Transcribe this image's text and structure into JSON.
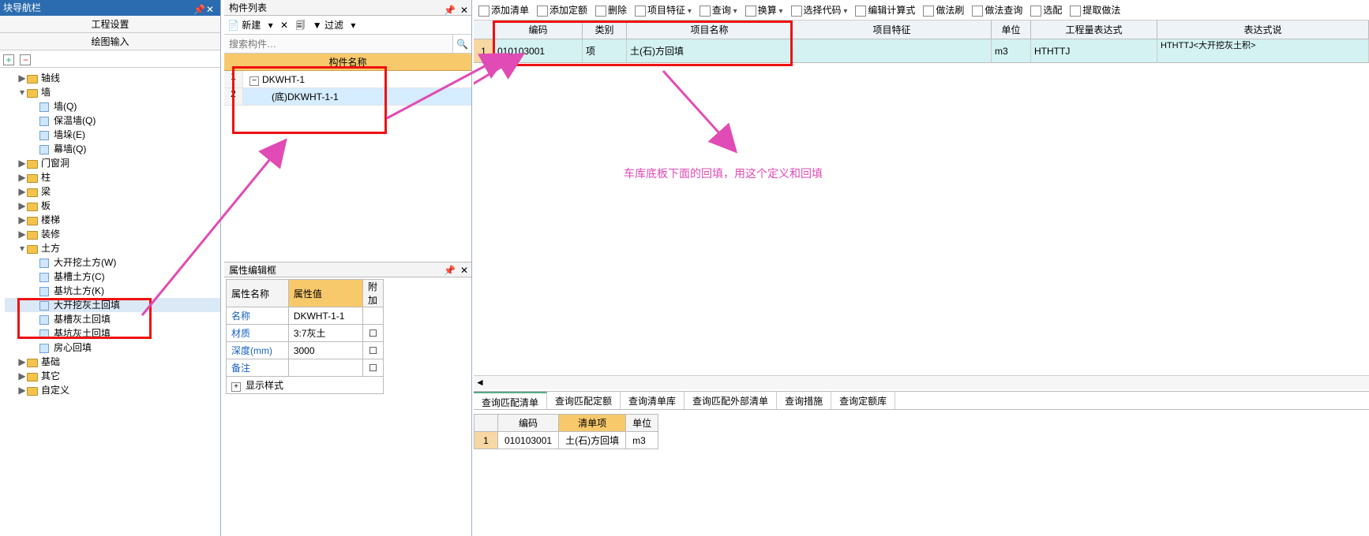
{
  "nav": {
    "title": "块导航栏",
    "header1": "工程设置",
    "header2": "绘图输入",
    "tree": [
      {
        "lvl": 0,
        "tg": "▶",
        "ic": "f",
        "label": "轴线"
      },
      {
        "lvl": 0,
        "tg": "▾",
        "ic": "f",
        "label": "墙"
      },
      {
        "lvl": 1,
        "tg": "",
        "ic": "l",
        "label": "墙(Q)"
      },
      {
        "lvl": 1,
        "tg": "",
        "ic": "l",
        "label": "保温墙(Q)"
      },
      {
        "lvl": 1,
        "tg": "",
        "ic": "l",
        "label": "墙垛(E)"
      },
      {
        "lvl": 1,
        "tg": "",
        "ic": "l",
        "label": "幕墙(Q)"
      },
      {
        "lvl": 0,
        "tg": "▶",
        "ic": "f",
        "label": "门窗洞"
      },
      {
        "lvl": 0,
        "tg": "▶",
        "ic": "f",
        "label": "柱"
      },
      {
        "lvl": 0,
        "tg": "▶",
        "ic": "f",
        "label": "梁"
      },
      {
        "lvl": 0,
        "tg": "▶",
        "ic": "f",
        "label": "板"
      },
      {
        "lvl": 0,
        "tg": "▶",
        "ic": "f",
        "label": "楼梯"
      },
      {
        "lvl": 0,
        "tg": "▶",
        "ic": "f",
        "label": "装修"
      },
      {
        "lvl": 0,
        "tg": "▾",
        "ic": "f",
        "label": "土方"
      },
      {
        "lvl": 1,
        "tg": "",
        "ic": "l",
        "label": "大开挖土方(W)"
      },
      {
        "lvl": 1,
        "tg": "",
        "ic": "l",
        "label": "基槽土方(C)"
      },
      {
        "lvl": 1,
        "tg": "",
        "ic": "l",
        "label": "基坑土方(K)"
      },
      {
        "lvl": 1,
        "tg": "",
        "ic": "l",
        "label": "大开挖灰土回填",
        "sel": true
      },
      {
        "lvl": 1,
        "tg": "",
        "ic": "l",
        "label": "基槽灰土回填"
      },
      {
        "lvl": 1,
        "tg": "",
        "ic": "l",
        "label": "基坑灰土回填"
      },
      {
        "lvl": 1,
        "tg": "",
        "ic": "l",
        "label": "房心回填"
      },
      {
        "lvl": 0,
        "tg": "▶",
        "ic": "f",
        "label": "基础"
      },
      {
        "lvl": 0,
        "tg": "▶",
        "ic": "f",
        "label": "其它"
      },
      {
        "lvl": 0,
        "tg": "▶",
        "ic": "f",
        "label": "自定义"
      }
    ]
  },
  "mid": {
    "title": "构件列表",
    "tool_new": "新建",
    "tool_filter": "过滤",
    "search_ph": "搜索构件…",
    "head": "构件名称",
    "rows": [
      {
        "n": "1",
        "label": "DKWHT-1",
        "tg": "−"
      },
      {
        "n": "2",
        "label": "(底)DKWHT-1-1",
        "sel": true
      }
    ]
  },
  "prop": {
    "title": "属性编辑框",
    "h1": "属性名称",
    "h2": "属性值",
    "h3": "附加",
    "rows": [
      {
        "k": "名称",
        "v": "DKWHT-1-1",
        "cb": false
      },
      {
        "k": "材质",
        "v": "3:7灰土",
        "cb": true
      },
      {
        "k": "深度(mm)",
        "v": "3000",
        "cb": true
      },
      {
        "k": "备注",
        "v": "",
        "cb": true
      }
    ],
    "last": "显示样式"
  },
  "rtool": [
    {
      "t": "添加清单",
      "dd": false
    },
    {
      "t": "添加定额",
      "dd": false
    },
    {
      "t": "删除",
      "dd": false
    },
    {
      "t": "项目特征",
      "dd": true
    },
    {
      "t": "查询",
      "dd": true
    },
    {
      "t": "换算",
      "dd": true
    },
    {
      "t": "选择代码",
      "dd": true
    },
    {
      "t": "编辑计算式",
      "dd": false
    },
    {
      "t": "做法刷",
      "dd": false
    },
    {
      "t": "做法查询",
      "dd": false
    },
    {
      "t": "选配",
      "dd": false
    },
    {
      "t": "提取做法",
      "dd": false
    }
  ],
  "rhead": [
    "",
    "编码",
    "类别",
    "项目名称",
    "项目特征",
    "单位",
    "工程量表达式",
    "表达式说"
  ],
  "rrow": {
    "idx": "1",
    "code": "010103001",
    "cat": "项",
    "name": "土(石)方回填",
    "attr": "",
    "unit": "m3",
    "expr": "HTHTTJ",
    "desc": "HTHTTJ<大开挖灰土积>"
  },
  "annot": "车库底板下面的回填，用这个定义和回填",
  "btabs": [
    "查询匹配清单",
    "查询匹配定额",
    "查询清单库",
    "查询匹配外部清单",
    "查询措施",
    "查询定额库"
  ],
  "bhead": [
    "",
    "编码",
    "清单项",
    "单位"
  ],
  "brow": {
    "idx": "1",
    "code": "010103001",
    "item": "土(石)方回填",
    "unit": "m3"
  }
}
